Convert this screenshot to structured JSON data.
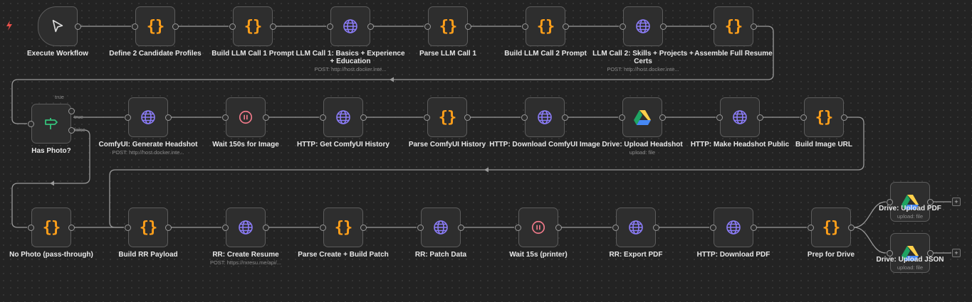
{
  "nodes": {
    "execute_workflow": {
      "label": "Execute Workflow"
    },
    "define_candidates": {
      "label": "Define 2 Candidate Profiles"
    },
    "build_llm1_prompt": {
      "label": "Build LLM Call 1 Prompt"
    },
    "llm_call_1": {
      "label": "LLM Call 1: Basics + Experience + Education",
      "sub": "POST: http://host.docker.inte..."
    },
    "parse_llm1": {
      "label": "Parse LLM Call 1"
    },
    "build_llm2_prompt": {
      "label": "Build LLM Call 2 Prompt"
    },
    "llm_call_2": {
      "label": "LLM Call 2: Skills + Projects + Certs",
      "sub": "POST: http://host.docker.inte..."
    },
    "assemble_resume": {
      "label": "Assemble Full Resume"
    },
    "has_photo": {
      "label": "Has Photo?",
      "true_label": "true",
      "false_label": "false"
    },
    "comfy_generate": {
      "label": "ComfyUI: Generate Headshot",
      "sub": "POST: http://host.docker.inte..."
    },
    "wait_150": {
      "label": "Wait 150s for Image"
    },
    "http_get_history": {
      "label": "HTTP: Get ComfyUI History"
    },
    "parse_history": {
      "label": "Parse ComfyUI History"
    },
    "http_download_image": {
      "label": "HTTP: Download ComfyUI Image"
    },
    "drive_upload_headshot": {
      "label": "Drive: Upload Headshot",
      "sub": "upload: file"
    },
    "http_make_public": {
      "label": "HTTP: Make Headshot Public"
    },
    "build_image_url": {
      "label": "Build Image URL"
    },
    "no_photo": {
      "label": "No Photo (pass-through)"
    },
    "build_rr_payload": {
      "label": "Build RR Payload"
    },
    "rr_create": {
      "label": "RR: Create Resume",
      "sub": "POST: https://rxresu.me/api/..."
    },
    "parse_create": {
      "label": "Parse Create + Build Patch"
    },
    "rr_patch": {
      "label": "RR: Patch Data"
    },
    "wait_15": {
      "label": "Wait 15s (printer)"
    },
    "rr_export": {
      "label": "RR: Export PDF"
    },
    "http_download_pdf": {
      "label": "HTTP: Download PDF"
    },
    "prep_drive": {
      "label": "Prep for Drive"
    },
    "drive_upload_pdf": {
      "label": "Drive: Upload PDF",
      "sub": "upload: file"
    },
    "drive_upload_json": {
      "label": "Drive: Upload JSON",
      "sub": "upload: file"
    }
  },
  "add_buttons": [
    "+",
    "+"
  ],
  "icons": {
    "code": "code-braces-icon",
    "http": "globe-icon",
    "wait": "pause-icon",
    "if": "signpost-icon",
    "drive": "google-drive-icon",
    "trigger": "cursor-icon",
    "bolt": "lightning-bolt-icon"
  },
  "colors": {
    "code": "#ff9f1a",
    "http": "#8b7cf7",
    "wait": "#f07a8a",
    "if": "#35c07a",
    "bolt": "#e8504a",
    "drive_green": "#1fa463",
    "drive_blue": "#4688f4",
    "drive_yellow": "#ffd04b"
  }
}
